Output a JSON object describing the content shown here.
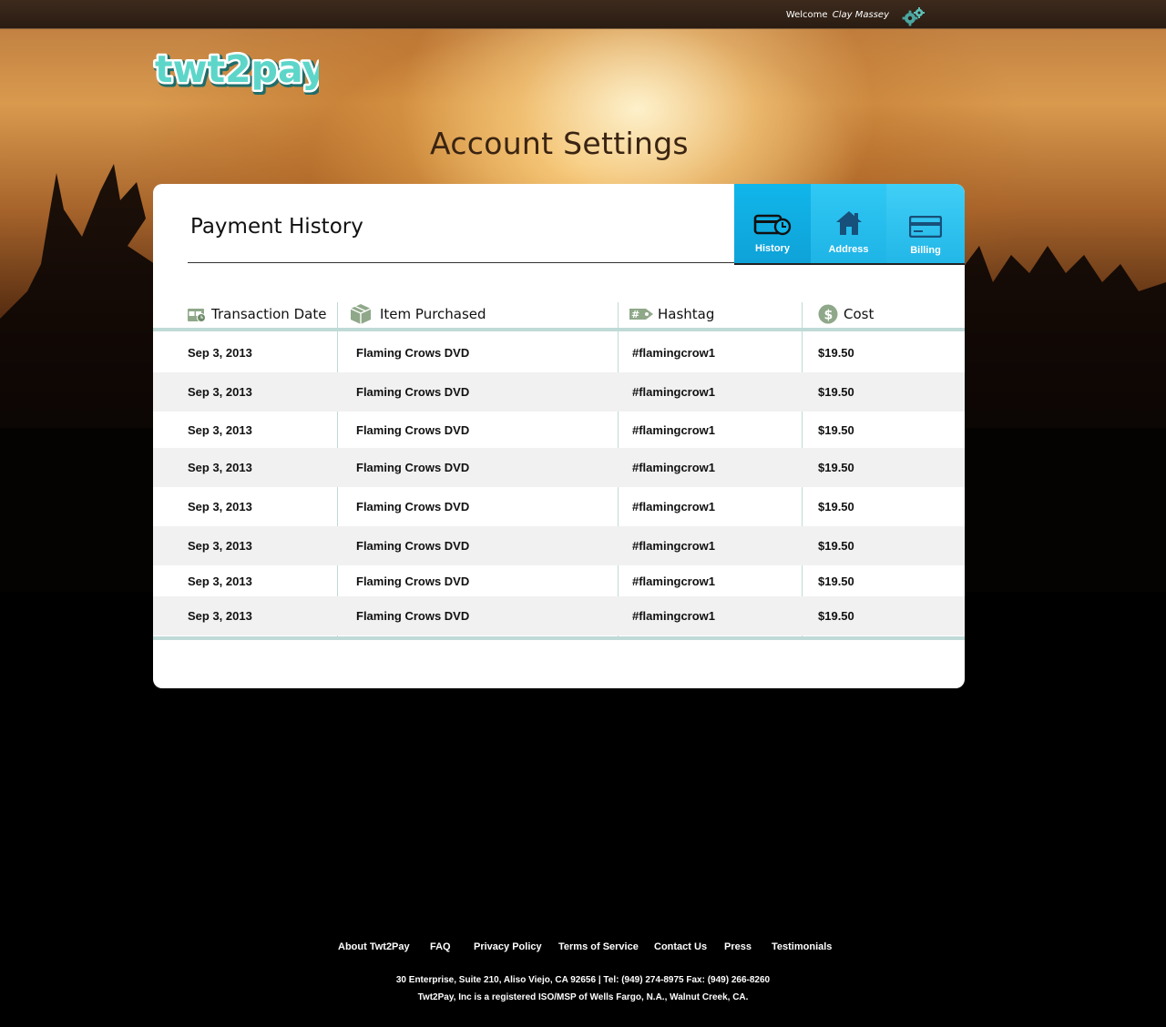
{
  "header": {
    "welcome_prefix": "Welcome",
    "user_name": "Clay Massey"
  },
  "brand": {
    "logo_text": "twt2pay",
    "logo_color": "#5dd6c9"
  },
  "page": {
    "title": "Account Settings"
  },
  "panel": {
    "section_title": "Payment History",
    "tabs": [
      {
        "label": "History",
        "icon": "history-card-clock-icon",
        "active": true
      },
      {
        "label": "Address",
        "icon": "home-icon",
        "active": false
      },
      {
        "label": "Billing",
        "icon": "credit-card-icon",
        "active": false
      }
    ],
    "accent_color": "#10b6ea"
  },
  "table": {
    "columns": [
      {
        "label": "Transaction Date",
        "icon": "calendar-icon"
      },
      {
        "label": "Item Purchased",
        "icon": "package-box-icon"
      },
      {
        "label": "Hashtag",
        "icon": "hashtag-tag-icon"
      },
      {
        "label": "Cost",
        "icon": "dollar-coin-icon"
      }
    ],
    "rows": [
      [
        "Sep 3, 2013",
        "Flaming Crows DVD",
        "#flamingcrow1",
        "$19.50"
      ],
      [
        "Sep 3, 2013",
        "Flaming Crows DVD",
        "#flamingcrow1",
        "$19.50"
      ],
      [
        "Sep 3, 2013",
        "Flaming Crows DVD",
        "#flamingcrow1",
        "$19.50"
      ],
      [
        "Sep 3, 2013",
        "Flaming Crows DVD",
        "#flamingcrow1",
        "$19.50"
      ],
      [
        "Sep 3, 2013",
        "Flaming Crows DVD",
        "#flamingcrow1",
        "$19.50"
      ],
      [
        "Sep 3, 2013",
        "Flaming Crows DVD",
        "#flamingcrow1",
        "$19.50"
      ],
      [
        "Sep 3, 2013",
        "Flaming Crows DVD",
        "#flamingcrow1",
        "$19.50"
      ],
      [
        "Sep 3, 2013",
        "Flaming Crows DVD",
        "#flamingcrow1",
        "$19.50"
      ]
    ]
  },
  "footer": {
    "links": [
      "About Twt2Pay",
      "FAQ",
      "Privacy Policy",
      "Terms of Service",
      "Contact Us",
      "Press",
      "Testimonials"
    ],
    "address": "30 Enterprise, Suite 210, Aliso Viejo, CA 92656 | Tel: (949) 274-8975 Fax: (949) 266-8260",
    "legal": "Twt2Pay, Inc is a registered ISO/MSP of Wells Fargo, N.A., Walnut Creek, CA."
  }
}
